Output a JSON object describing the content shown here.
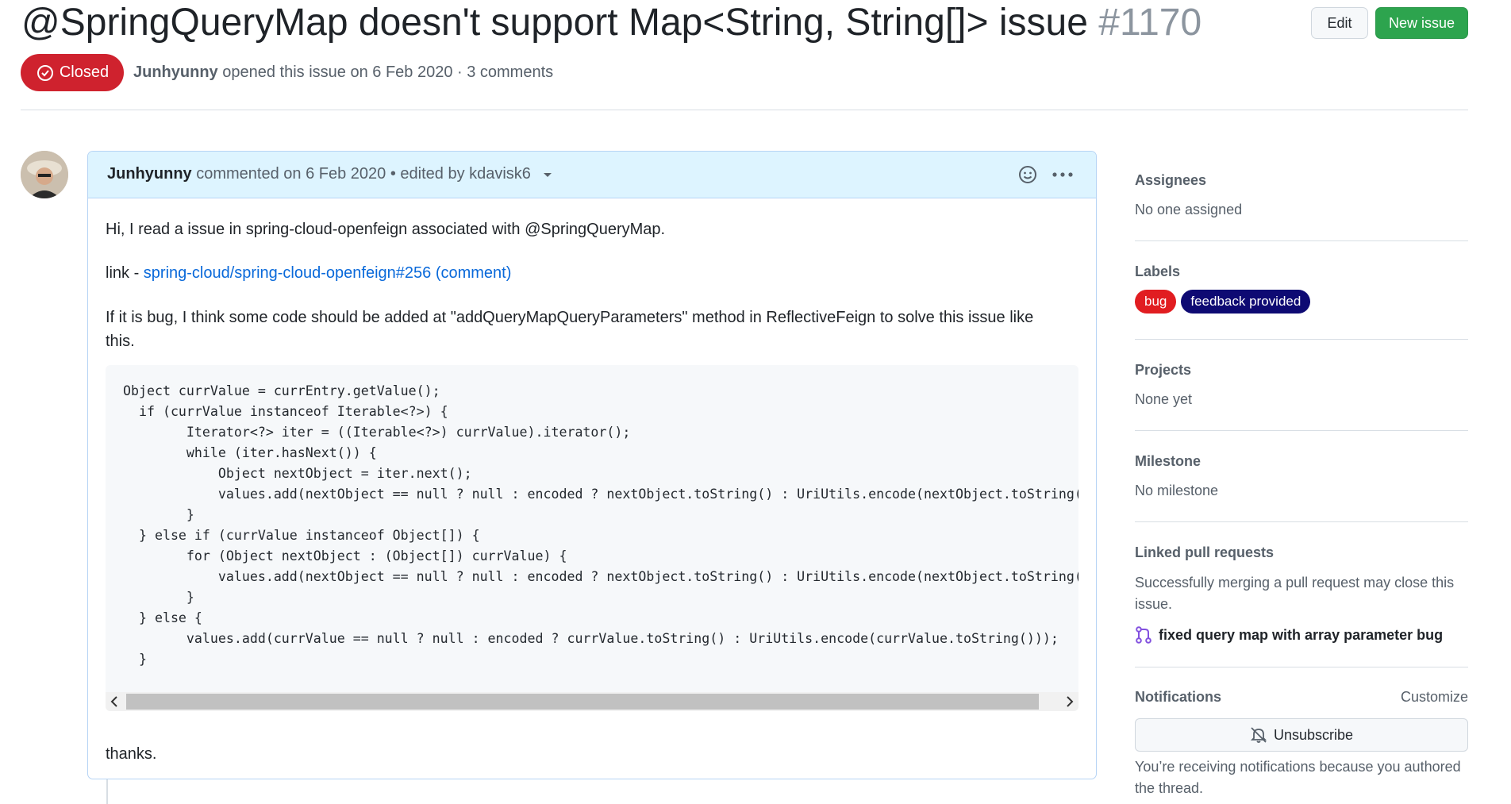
{
  "header": {
    "title": "@SpringQueryMap doesn't support Map<String, String[]> issue",
    "number": "#1170",
    "edit_label": "Edit",
    "new_issue_label": "New issue",
    "state_label": "Closed",
    "author": "Junhyunny",
    "meta_rest": "opened this issue on 6 Feb 2020 · 3 comments"
  },
  "comment": {
    "author": "Junhyunny",
    "meta": "commented on 6 Feb 2020 • edited by kdavisk6",
    "para1": "Hi, I read a issue in spring-cloud-openfeign associated with @SpringQueryMap.",
    "link_prefix": "link - ",
    "link_text": "spring-cloud/spring-cloud-openfeign#256 (comment)",
    "para3_line1": "If it is bug, I think some code should be added at \"addQueryMapQueryParameters\" method in ReflectiveFeign to solve this issue like",
    "para3_line2": "this.",
    "code_lines": [
      "Object currValue = currEntry.getValue();",
      "  if (currValue instanceof Iterable<?>) {",
      "        Iterator<?> iter = ((Iterable<?>) currValue).iterator();",
      "        while (iter.hasNext()) {",
      "            Object nextObject = iter.next();",
      "            values.add(nextObject == null ? null : encoded ? nextObject.toString() : UriUtils.encode(nextObject.toString()",
      "        }",
      "  } else if (currValue instanceof Object[]) {",
      "        for (Object nextObject : (Object[]) currValue) {",
      "            values.add(nextObject == null ? null : encoded ? nextObject.toString() : UriUtils.encode(nextObject.toString()",
      "        }",
      "  } else {",
      "        values.add(currValue == null ? null : encoded ? currValue.toString() : UriUtils.encode(currValue.toString()));",
      "  }"
    ],
    "closing": "thanks."
  },
  "sidebar": {
    "assignees_title": "Assignees",
    "assignees_value": "No one assigned",
    "labels_title": "Labels",
    "labels": [
      {
        "name": "bug",
        "color": "#e11d21"
      },
      {
        "name": "feedback provided",
        "color": "#0e0a73"
      }
    ],
    "projects_title": "Projects",
    "projects_value": "None yet",
    "milestone_title": "Milestone",
    "milestone_value": "No milestone",
    "linked_title": "Linked pull requests",
    "linked_desc_line1": "Successfully merging a pull request may close this",
    "linked_desc_line2": "issue.",
    "linked_pr": "fixed query map with array parameter bug",
    "notifications_title": "Notifications",
    "customize_label": "Customize",
    "unsubscribe_label": "Unsubscribe",
    "notif_desc_line1": "You’re receiving notifications because you authored",
    "notif_desc_line2": "the thread."
  },
  "icons": {
    "state": "closed-issue-icon",
    "emoji": "smiley-icon",
    "more": "kebab-horizontal-icon",
    "caret": "triangle-down-icon",
    "pr": "git-pull-request-icon",
    "bell": "bell-slash-icon"
  },
  "colors": {
    "closed_red": "#cf222e",
    "new_issue_green": "#2da44e",
    "link_blue": "#0969da",
    "comment_header_bg": "#ddf4ff"
  }
}
